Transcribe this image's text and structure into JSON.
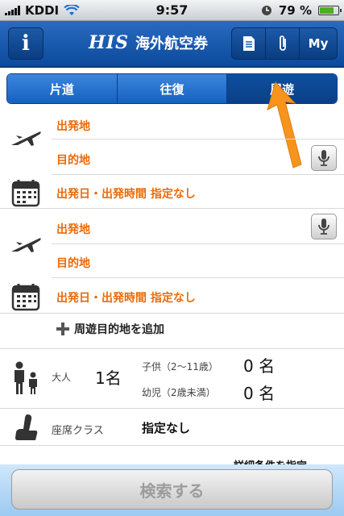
{
  "status_bar": {
    "carrier": "KDDI",
    "time": "9:57",
    "battery": "79 %",
    "battery_level": 0.79
  },
  "header": {
    "logo": "HIS",
    "title": "海外航空券",
    "my_label": "My"
  },
  "tabs": [
    {
      "label": "片道"
    },
    {
      "label": "往復"
    },
    {
      "label": "周遊",
      "active": true
    }
  ],
  "legs": [
    {
      "departure": "出発地",
      "destination": "目的地",
      "date_time": "出発日・出発時間 指定なし"
    },
    {
      "departure": "出発地",
      "destination": "目的地",
      "date_time": "出発日・出発時間 指定なし"
    }
  ],
  "add_destination": "周遊目的地を追加",
  "passengers": {
    "adult_label": "大人",
    "adult_count": "1名",
    "child_label": "子供（2〜11歳）",
    "child_count": "0 名",
    "infant_label": "幼児（2歳未満）",
    "infant_count": "0 名"
  },
  "seat": {
    "label": "座席クラス",
    "value": "指定なし"
  },
  "detail_link": "詳細条件を指定",
  "search_button": "検索する",
  "colors": {
    "brand_blue": "#0b4a9c",
    "accent_orange": "#ea6a08",
    "arrow_orange": "#f7941d"
  },
  "icons": [
    "wifi-icon",
    "clock-icon",
    "info-icon",
    "document-icon",
    "paperclip-icon",
    "plane-icon",
    "calendar-icon",
    "microphone-icon",
    "plus-icon",
    "family-icon",
    "seat-icon"
  ]
}
